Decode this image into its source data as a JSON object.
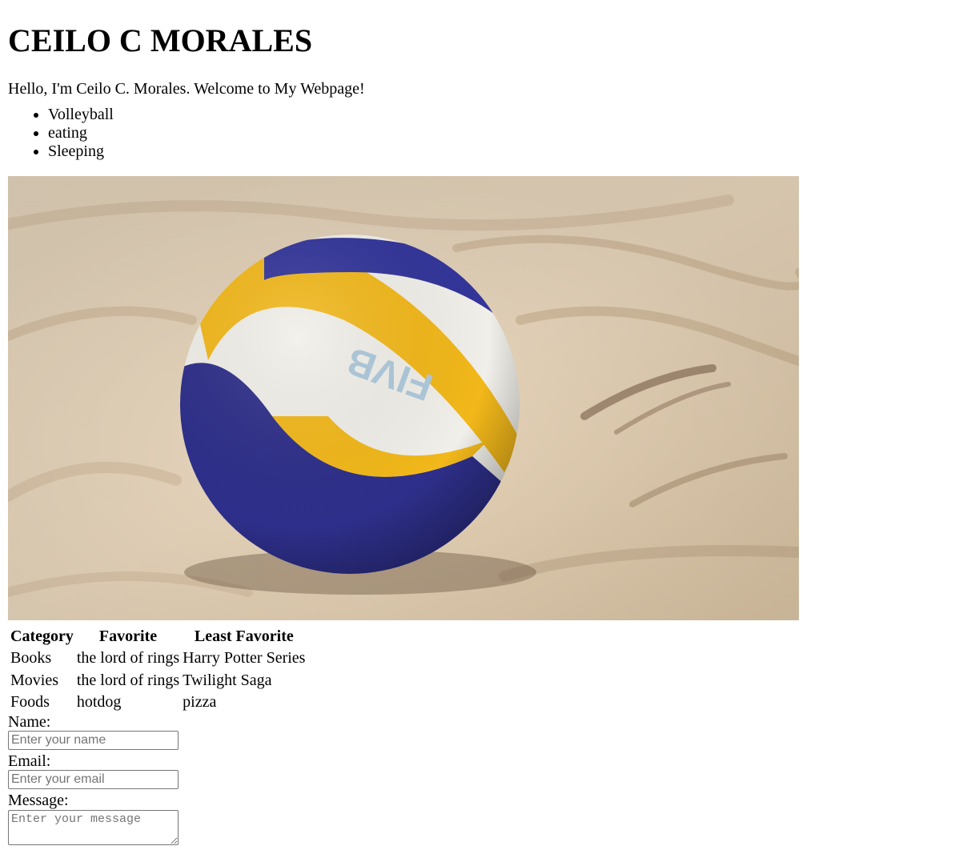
{
  "header": {
    "title": "CEILO C MORALES"
  },
  "intro": {
    "text": "Hello, I'm Ceilo C. Morales. Welcome to My Webpage!"
  },
  "hobbies": [
    "Volleyball",
    "eating",
    "Sleeping"
  ],
  "photo": {
    "subject": "volleyball-on-sand",
    "ball_text": "FIVB"
  },
  "table": {
    "headers": [
      "Category",
      "Favorite",
      "Least Favorite"
    ],
    "rows": [
      [
        "Books",
        "the lord of rings",
        "Harry Potter Series"
      ],
      [
        "Movies",
        "the lord of rings",
        "Twilight Saga"
      ],
      [
        "Foods",
        "hotdog",
        "pizza"
      ]
    ]
  },
  "form": {
    "name_label": "Name:",
    "name_placeholder": "Enter your name",
    "email_label": "Email:",
    "email_placeholder": "Enter your email",
    "message_label": "Message:",
    "message_placeholder": "Enter your message"
  }
}
